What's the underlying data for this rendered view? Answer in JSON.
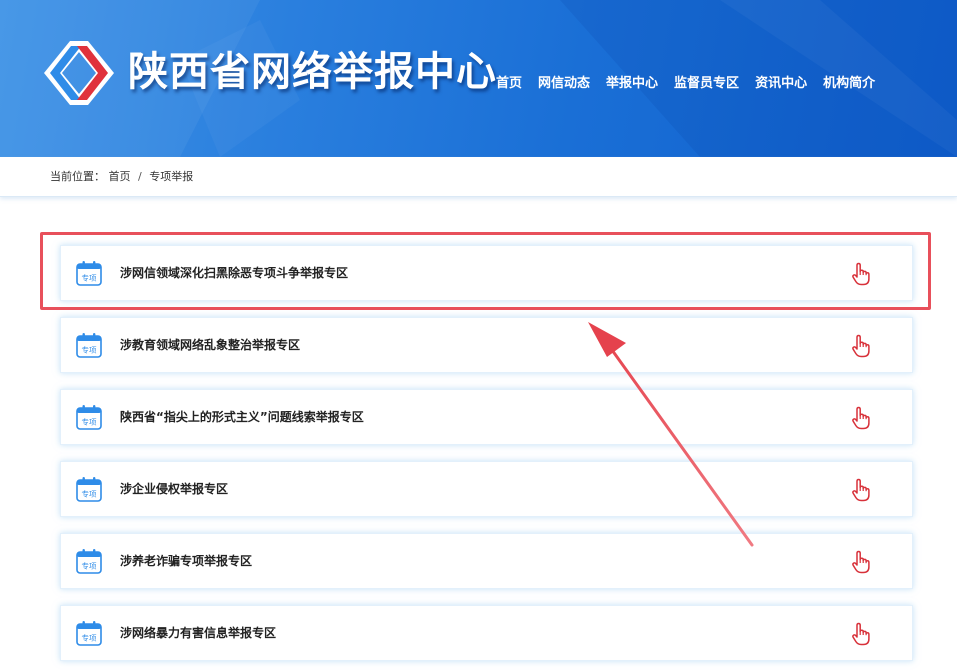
{
  "header": {
    "site_title": "陕西省网络举报中心",
    "nav": [
      {
        "label": "首页"
      },
      {
        "label": "网信动态"
      },
      {
        "label": "举报中心"
      },
      {
        "label": "监督员专区"
      },
      {
        "label": "资讯中心"
      },
      {
        "label": "机构简介"
      }
    ],
    "colors": {
      "primary": "#1a6fd6",
      "logo_blue": "#2f8ce8",
      "logo_red": "#e0323c"
    }
  },
  "breadcrumb": {
    "prefix": "当前位置：",
    "home": "首页",
    "separator": "/",
    "current": "专项举报"
  },
  "list": {
    "badge_text": "专项",
    "items": [
      {
        "label": "涉网信领域深化扫黑除恶专项斗争举报专区"
      },
      {
        "label": "涉教育领域网络乱象整治举报专区"
      },
      {
        "label": "陕西省“指尖上的形式主义”问题线索举报专区"
      },
      {
        "label": "涉企业侵权举报专区"
      },
      {
        "label": "涉养老诈骗专项举报专区"
      },
      {
        "label": "涉网络暴力有害信息举报专区"
      }
    ],
    "colors": {
      "icon_blue": "#2f8ce8",
      "hand_red": "#d8313a"
    }
  },
  "annotation": {
    "color": "#e8505b",
    "highlighted_item_index": 0
  }
}
